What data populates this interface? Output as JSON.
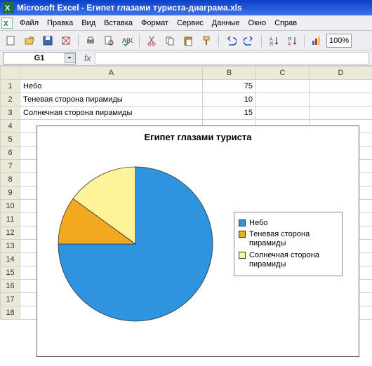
{
  "window": {
    "app_name": "Microsoft Excel",
    "doc_name": "Египет глазами туриста-диаграма.xls"
  },
  "menu": {
    "file": "Файл",
    "edit": "Правка",
    "view": "Вид",
    "insert": "Вставка",
    "format": "Формат",
    "service": "Сервис",
    "data": "Данные",
    "window": "Окно",
    "help": "Справ"
  },
  "toolbar": {
    "zoom": "100%"
  },
  "namebox": {
    "ref": "G1",
    "fx": "fx"
  },
  "columns": {
    "A": "A",
    "B": "B",
    "C": "C",
    "D": "D"
  },
  "rows": [
    1,
    2,
    3,
    4,
    5,
    6,
    7,
    8,
    9,
    10,
    11,
    12,
    13,
    14,
    15,
    16,
    17,
    18
  ],
  "cells": {
    "A1": "Небо",
    "B1": "75",
    "A2": "Теневая сторона пирамиды",
    "B2": "10",
    "A3": "Солнечная сторона пирамиды",
    "B3": "15"
  },
  "chart_data": {
    "type": "pie",
    "title": "Египет глазами туриста",
    "categories": [
      "Небо",
      "Теневая сторона пирамиды",
      "Солнечная сторона пирамиды"
    ],
    "values": [
      75,
      10,
      15
    ],
    "colors": [
      "#2f93e0",
      "#f3a91f",
      "#fff39a"
    ],
    "legend_position": "right"
  }
}
